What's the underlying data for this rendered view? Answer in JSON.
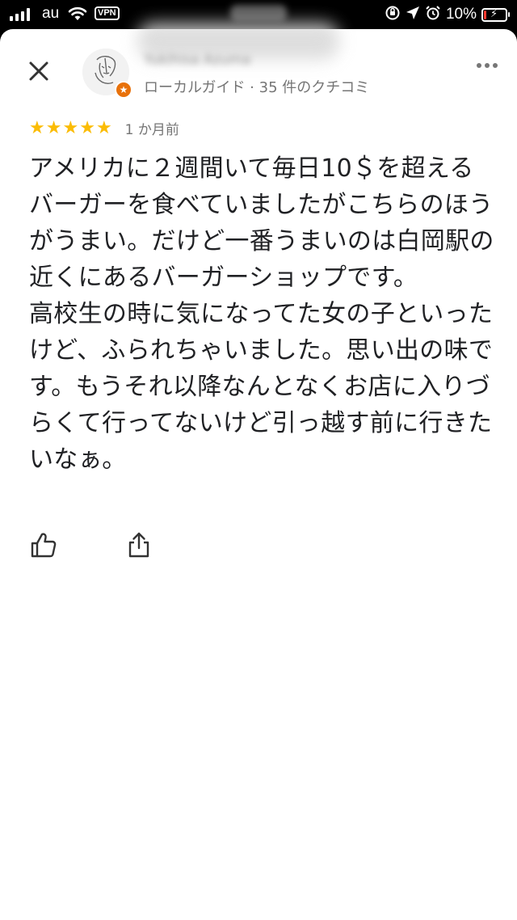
{
  "status_bar": {
    "carrier": "au",
    "vpn_label": "VPN",
    "battery_percent": "10%",
    "battery_level": 0.1
  },
  "reviewer": {
    "name": "Yukihisa Azuma",
    "subtitle": "ローカルガイド · 35 件のクチコミ"
  },
  "review": {
    "rating": 5,
    "stars": [
      "★",
      "★",
      "★",
      "★",
      "★"
    ],
    "time": "1 か月前",
    "text": "アメリカに２週間いて毎日10＄を超えるバーガーを食べていましたがこちらのほうがうまい。だけど一番うまいのは白岡駅の近くにあるバーガーショップです。\n高校生の時に気になってた女の子といったけど、ふられちゃいました。思い出の味です。もうそれ以降なんとなくお店に入りづらくて行ってないけど引っ越す前に行きたいなぁ。"
  },
  "colors": {
    "star": "#fbbc04",
    "badge": "#e8710a",
    "text": "#202124",
    "secondary_text": "#757575"
  },
  "icons": {
    "close": "close-icon",
    "more": "more-icon",
    "like": "thumbs-up-icon",
    "share": "share-icon"
  }
}
